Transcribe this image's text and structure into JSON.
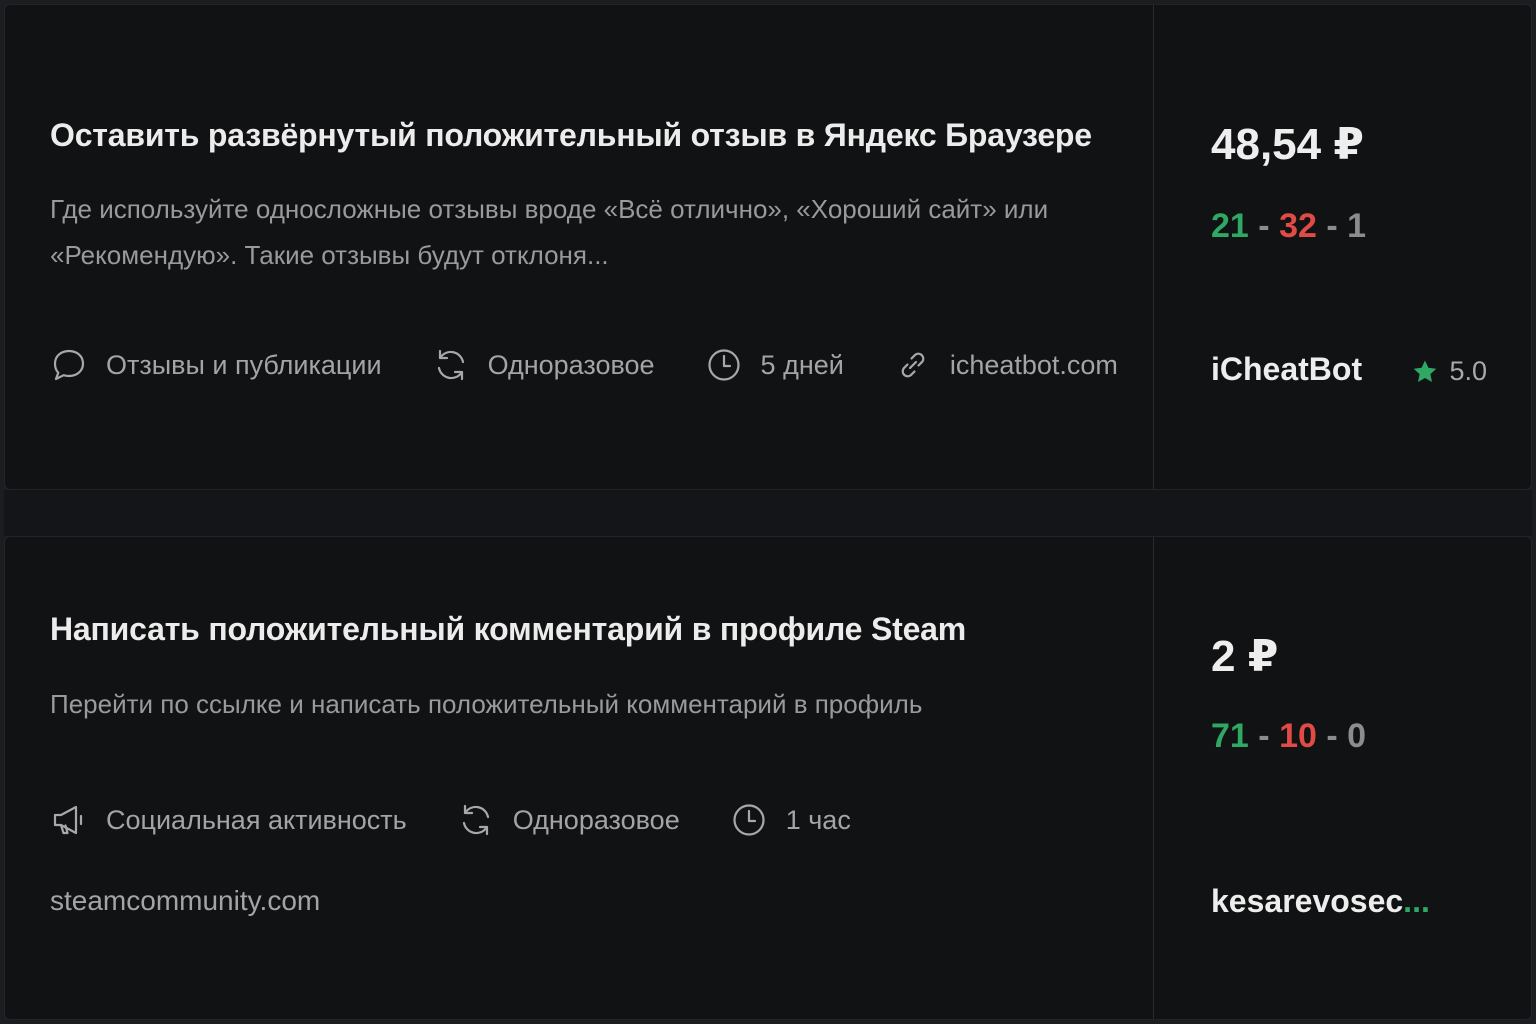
{
  "tasks": [
    {
      "title": "Оставить развёрнутый положительный отзыв в Яндекс Браузере",
      "description": "Где используйте односложные отзывы вроде «Всё отлично», «Хороший сайт» или «Рекомендую». Такие отзывы будут отклоня...",
      "category": "Отзывы и публикации",
      "frequency": "Одноразовое",
      "duration": "5 дней",
      "link": "icheatbot.com",
      "price": "48,54 ₽",
      "stats": {
        "positive": "21",
        "negative": "32",
        "neutral": "1",
        "separator": "-"
      },
      "author": "iCheatBot",
      "rating": "5.0"
    },
    {
      "title": "Написать положительный комментарий в профиле Steam",
      "description": "Перейти по ссылке и написать положительный комментарий в профиль",
      "category": "Социальная активность",
      "frequency": "Одноразовое",
      "duration": "1 час",
      "link": "steamcommunity.com",
      "price": "2 ₽",
      "stats": {
        "positive": "71",
        "negative": "10",
        "neutral": "0",
        "separator": "-"
      },
      "author": "kesarevosec",
      "author_ellipsis": "..."
    }
  ],
  "icons": {
    "category_1": "comment-icon",
    "category_2": "megaphone-icon",
    "frequency": "refresh-icon",
    "duration": "clock-icon",
    "link": "link-icon",
    "rating": "star-icon"
  },
  "colors": {
    "positive": "#2fa864",
    "negative": "#e04b45",
    "star": "#2fa864"
  }
}
